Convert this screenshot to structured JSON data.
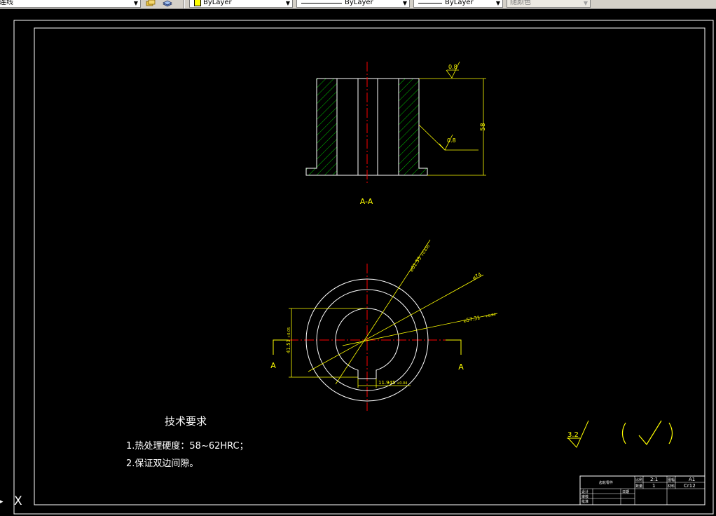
{
  "toolbar": {
    "linetype_value": "连线",
    "color_value": "ByLayer",
    "linetype2_value": "ByLayer",
    "lineweight_value": "ByLayer",
    "plotstyle_value": "随颜色"
  },
  "drawing": {
    "section_label": "A-A",
    "view_label_left": "A",
    "view_label_right": "A",
    "dim_height": "58",
    "roughness_top": "0.8",
    "roughness_inner": "0.8",
    "dim_dia_outer": "⌀74",
    "dim_dia_bore": "⌀61.55",
    "dim_dia_bore_tol": "+0.030",
    "dim_dia_small": "⌀57.31",
    "dim_dia_small_tol": "+0.04",
    "dim_vertical": "41.51",
    "dim_vertical_tol": "+0.05",
    "dim_key_width": "11.945",
    "dim_key_width_tol": "+0.04",
    "default_roughness": "3.2",
    "tech_title": "技术要求",
    "tech_items": [
      "1.热处理硬度：58~62HRC；",
      "2.保证双边间隙。"
    ],
    "ucs_x": "X"
  },
  "title_block": {
    "part_name": "齿轮零件",
    "scale_label": "比例",
    "scale_value": "2:1",
    "sheet_label": "图幅",
    "sheet_value": "A1",
    "qty_label": "数量",
    "qty_value": "1",
    "material_label": "材料",
    "material_value": "Cr12",
    "designer_label": "设计",
    "checker_label": "审核",
    "approver_label": "批准",
    "date_label": "日期"
  },
  "colors": {
    "background": "#000000",
    "dimension": "#ffff00",
    "outline": "#ffffff",
    "centerline": "#ff0000",
    "hatch": "#00c000"
  }
}
